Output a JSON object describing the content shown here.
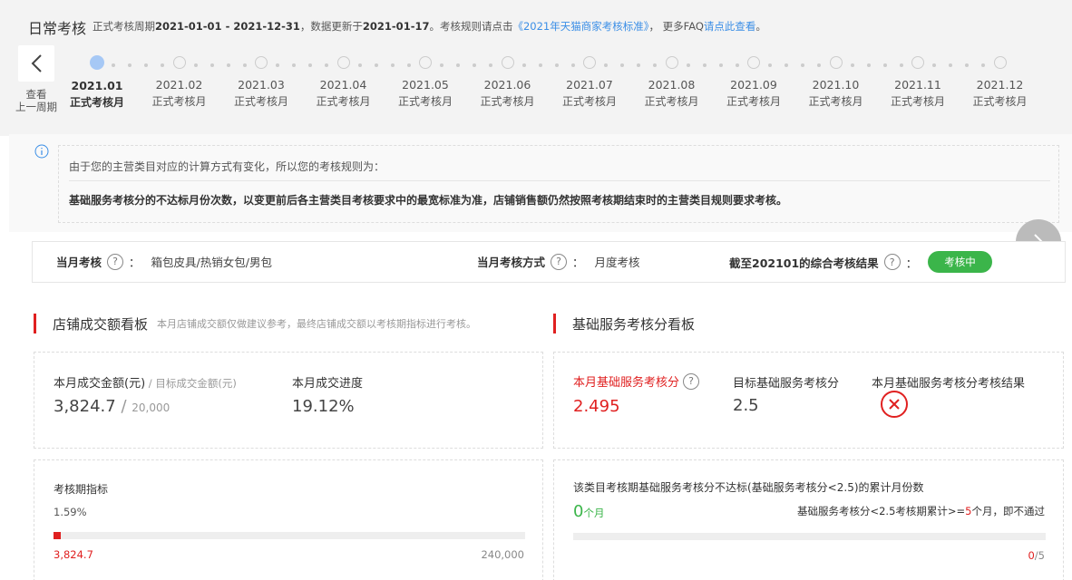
{
  "header": {
    "title": "日常考核",
    "period_prefix": "正式考核周期",
    "period_range": "2021-01-01 - 2021-12-31",
    "update_prefix": "，数据更新于",
    "update_date": "2021-01-17",
    "rules_prefix": "。考核规则请点击",
    "rules_link": "《2021年天猫商家考核标准》",
    "faq_prefix": "， 更多FAQ",
    "faq_link": "请点此查看",
    "faq_suffix": "。"
  },
  "timeline": {
    "back_label_line1": "查看",
    "back_label_line2": "上一周期",
    "months": [
      {
        "date": "2021.01",
        "type": "正式考核月"
      },
      {
        "date": "2021.02",
        "type": "正式考核月"
      },
      {
        "date": "2021.03",
        "type": "正式考核月"
      },
      {
        "date": "2021.04",
        "type": "正式考核月"
      },
      {
        "date": "2021.05",
        "type": "正式考核月"
      },
      {
        "date": "2021.06",
        "type": "正式考核月"
      },
      {
        "date": "2021.07",
        "type": "正式考核月"
      },
      {
        "date": "2021.08",
        "type": "正式考核月"
      },
      {
        "date": "2021.09",
        "type": "正式考核月"
      },
      {
        "date": "2021.10",
        "type": "正式考核月"
      },
      {
        "date": "2021.11",
        "type": "正式考核月"
      },
      {
        "date": "2021.12",
        "type": "正式考核月"
      }
    ]
  },
  "notice": {
    "line1": "由于您的主营类目对应的计算方式有变化，所以您的考核规则为：",
    "line2": "基础服务考核分的不达标月份次数，以变更前后各主营类目考核要求中的最宽标准为准，店铺销售额仍然按照考核期结束时的主营类目规则要求考核。"
  },
  "infobar": {
    "category_label": "当月考核",
    "category_value": "箱包皮具/热销女包/男包",
    "method_label": "当月考核方式",
    "method_value": "月度考核",
    "result_label": "截至202101的综合考核结果",
    "result_badge": "考核中",
    "colon": "："
  },
  "sales_board": {
    "title": "店铺成交额看板",
    "subtitle": "本月店铺成交额仅做建议参考，最终店铺成交额以考核期指标进行考核。",
    "amount_label": "本月成交金额(元)",
    "slash": " / ",
    "target_label": "目标成交金额(元)",
    "amount_value": "3,824.7",
    "target_value": "20,000",
    "progress_label": "本月成交进度",
    "progress_value": "19.12%",
    "period_label": "考核期指标",
    "period_percent": "1.59%",
    "period_progress": 0.0159,
    "period_current": "3,824.7",
    "period_target": "240,000"
  },
  "service_board": {
    "title": "基础服务考核分看板",
    "score_label": "本月基础服务考核分",
    "score_value": "2.495",
    "target_label": "目标基础服务考核分",
    "target_value": "2.5",
    "result_label": "本月基础服务考核分考核结果",
    "count_label": "该类目考核期基础服务考核分不达标(基础服务考核分<2.5)的累计月份数",
    "count_value": "0",
    "count_unit": "个月",
    "rule_prefix": "基础服务考核分<2.5考核期累计>=",
    "rule_number": "5",
    "rule_suffix": "个月，即不通过",
    "count_current": "0",
    "count_total": "/5",
    "count_progress": 0
  },
  "colors": {
    "accent_red": "#e02020",
    "accent_green": "#3bb54a",
    "link_blue": "#3a8ee6"
  }
}
